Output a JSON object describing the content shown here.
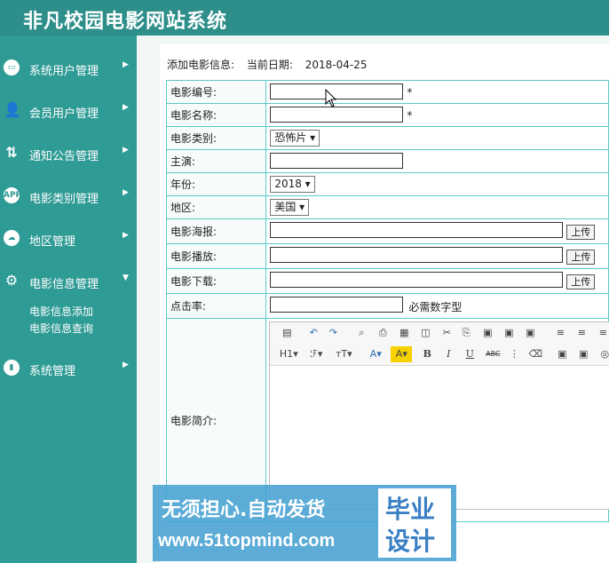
{
  "app": {
    "title": "非凡校园电影网站系统"
  },
  "sidebar": {
    "items": [
      {
        "label": "系统用户管理",
        "icon": "monitor-icon"
      },
      {
        "label": "会员用户管理",
        "icon": "user-gear-icon"
      },
      {
        "label": "通知公告管理",
        "icon": "sort-arrows-icon"
      },
      {
        "label": "电影类别管理",
        "icon": "app-icon"
      },
      {
        "label": "地区管理",
        "icon": "cloud-icon"
      },
      {
        "label": "电影信息管理",
        "icon": "settings-icon"
      },
      {
        "label": "系统管理",
        "icon": "bar-chart-icon"
      }
    ],
    "subitems": [
      "电影信息添加",
      "电影信息查询"
    ]
  },
  "page": {
    "heading": "添加电影信息:",
    "date_label": "当前日期:",
    "date_value": "2018-04-25"
  },
  "form": {
    "labels": {
      "id": "电影编号:",
      "name": "电影名称:",
      "category": "电影类别:",
      "star": "主演:",
      "year": "年份:",
      "region": "地区:",
      "poster": "电影海报:",
      "play": "电影播放:",
      "download": "电影下载:",
      "clicks": "点击率:",
      "intro": "电影简介:"
    },
    "required_mark": "*",
    "category_selected": "恐怖片",
    "year_selected": "2018",
    "region_selected": "美国",
    "upload_label": "上传",
    "clicks_hint": "必需数字型"
  },
  "editor": {
    "heading_label": "H1",
    "font_label": "ℱ",
    "size_label": "тT",
    "color_label": "A",
    "bold": "B",
    "italic": "I",
    "underline": "U",
    "abc": "ABC"
  },
  "watermark": {
    "line1": "无须担心.自动发货",
    "line2": "www.51topmind.com",
    "badge1": "毕业",
    "badge2": "设计"
  }
}
